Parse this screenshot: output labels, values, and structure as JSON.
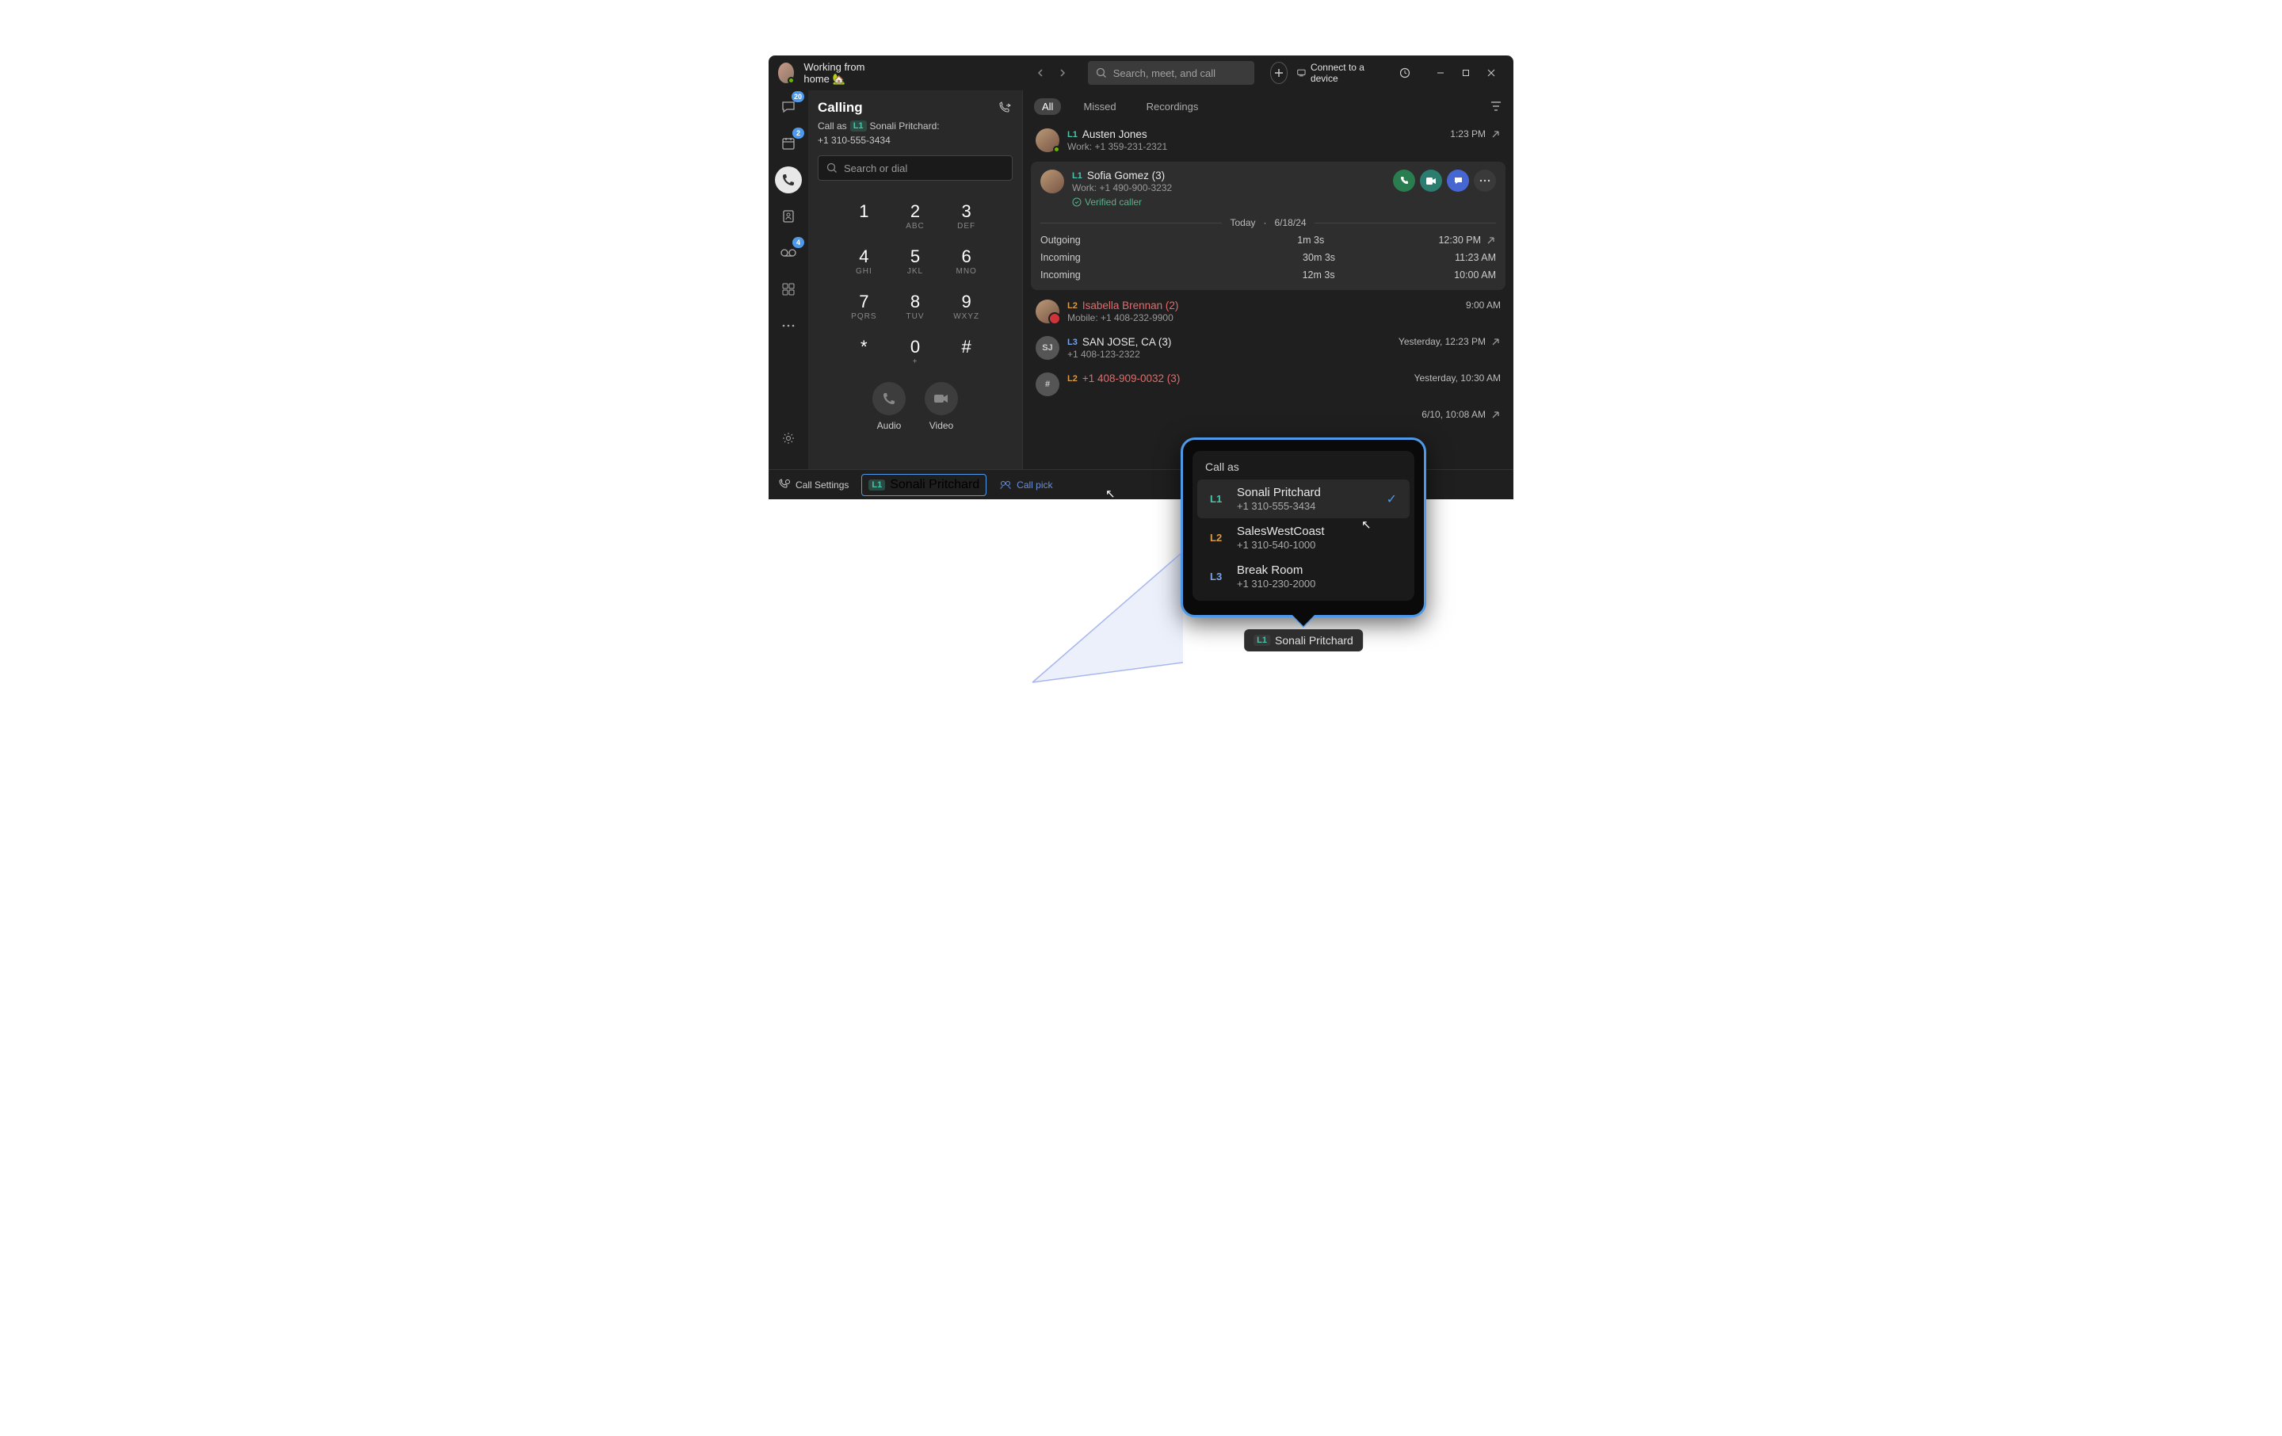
{
  "titlebar": {
    "status": "Working from home 🏡",
    "search_placeholder": "Search, meet, and call",
    "connect": "Connect to a device"
  },
  "navrail": {
    "chat_badge": "20",
    "calendar_badge": "2",
    "voicemail_badge": "4"
  },
  "calling": {
    "title": "Calling",
    "call_as_prefix": "Call as",
    "line_tag": "L1",
    "line_name": "Sonali Pritchard:",
    "line_number": "+1 310-555-3434",
    "search_placeholder": "Search or dial",
    "keys": [
      {
        "num": "1",
        "sub": ""
      },
      {
        "num": "2",
        "sub": "ABC"
      },
      {
        "num": "3",
        "sub": "DEF"
      },
      {
        "num": "4",
        "sub": "GHI"
      },
      {
        "num": "5",
        "sub": "JKL"
      },
      {
        "num": "6",
        "sub": "MNO"
      },
      {
        "num": "7",
        "sub": "PQRS"
      },
      {
        "num": "8",
        "sub": "TUV"
      },
      {
        "num": "9",
        "sub": "WXYZ"
      },
      {
        "num": "*",
        "sub": ""
      },
      {
        "num": "0",
        "sub": "+"
      },
      {
        "num": "#",
        "sub": ""
      }
    ],
    "audio_label": "Audio",
    "video_label": "Video"
  },
  "bottom": {
    "settings": "Call Settings",
    "pill_tag": "L1",
    "pill_name": "Sonali Pritchard",
    "pickup": "Call pick"
  },
  "history": {
    "tabs": {
      "all": "All",
      "missed": "Missed",
      "recordings": "Recordings"
    },
    "divider_today": "Today",
    "divider_date": "6/18/24",
    "entries": [
      {
        "line": "L1",
        "lineClass": "l1",
        "name": "Austen Jones",
        "sub": "Work: +1 359-231-2321",
        "time": "1:23 PM",
        "out": true
      },
      {
        "line": "L2",
        "lineClass": "l2",
        "name": "Isabella Brennan (2)",
        "sub": "Mobile: +1 408-232-9900",
        "time": "9:00 AM",
        "missed": true
      },
      {
        "line": "L3",
        "lineClass": "l3",
        "name": "SAN JOSE, CA (3)",
        "sub": "+1 408-123-2322",
        "time": "Yesterday, 12:23 PM",
        "out": true,
        "initials": "SJ"
      },
      {
        "line": "L2",
        "lineClass": "l2",
        "name": "+1 408-909-0032 (3)",
        "time": "Yesterday, 10:30 AM",
        "missed": true,
        "hash": true
      },
      {
        "time": "6/10, 10:08 AM",
        "out": true,
        "tail": true
      }
    ],
    "expanded": {
      "line": "L1",
      "name": "Sofia Gomez (3)",
      "sub": "Work: +1 490-900-3232",
      "verified": "Verified caller",
      "rows": [
        {
          "type": "Outgoing",
          "dur": "1m 3s",
          "time": "12:30 PM",
          "out": true
        },
        {
          "type": "Incoming",
          "dur": "30m 3s",
          "time": "11:23 AM"
        },
        {
          "type": "Incoming",
          "dur": "12m 3s",
          "time": "10:00 AM"
        }
      ]
    }
  },
  "popover": {
    "title": "Call as",
    "options": [
      {
        "code": "L1",
        "cls": "l1",
        "name": "Sonali Pritchard",
        "number": "+1 310-555-3434",
        "selected": true
      },
      {
        "code": "L2",
        "cls": "l2",
        "name": "SalesWestCoast",
        "number": "+1 310-540-1000"
      },
      {
        "code": "L3",
        "cls": "l3",
        "name": "Break Room",
        "number": "+1 310-230-2000"
      }
    ],
    "chip_tag": "L1",
    "chip_name": "Sonali Pritchard"
  }
}
